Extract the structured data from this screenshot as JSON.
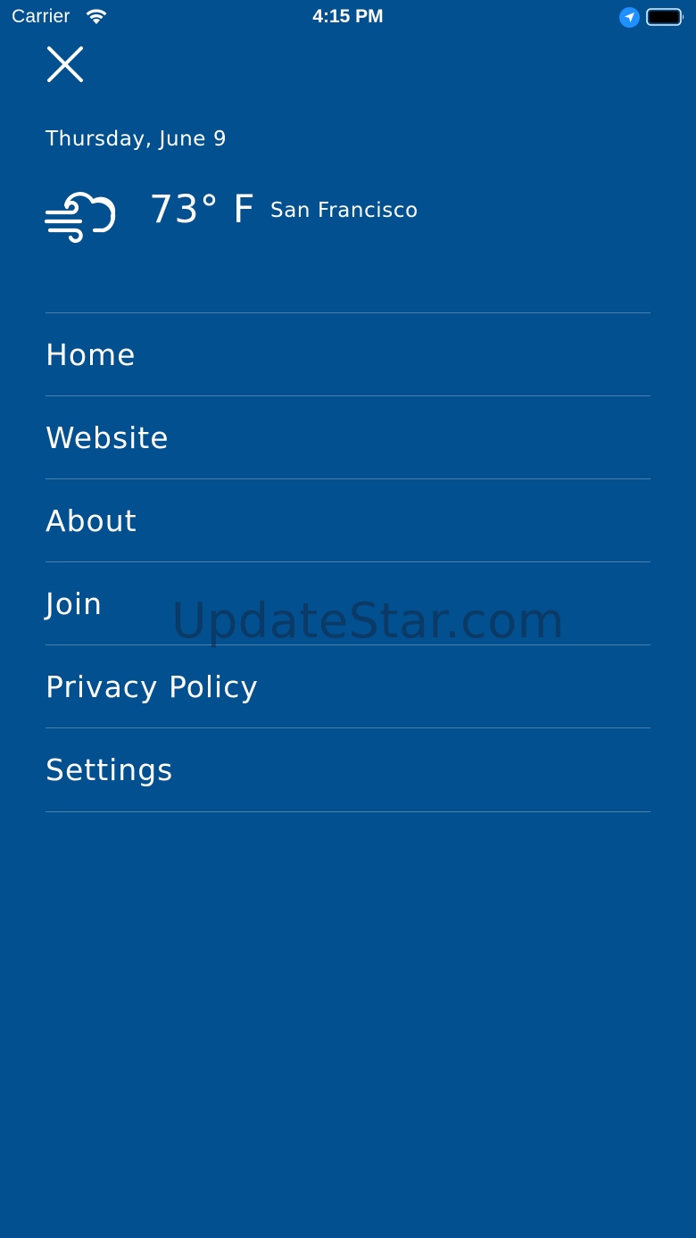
{
  "status_bar": {
    "carrier": "Carrier",
    "time": "4:15 PM",
    "icons": [
      "wifi-icon",
      "location-arrow-icon",
      "battery-icon"
    ]
  },
  "header": {
    "close_icon": "close-icon",
    "date": "Thursday, June 9",
    "weather_icon": "windy-cloud-icon",
    "temperature": "73° F",
    "location": "San Francisco"
  },
  "menu": {
    "items": [
      {
        "label": "Home"
      },
      {
        "label": "Website"
      },
      {
        "label": "About"
      },
      {
        "label": "Join"
      },
      {
        "label": "Privacy Policy"
      },
      {
        "label": "Settings"
      }
    ]
  },
  "watermark": "UpdateStar.com",
  "colors": {
    "background": "#02508F",
    "text": "#FFFFFF",
    "divider": "rgba(255,255,255,0.28)",
    "location_icon": "#1E90FF"
  }
}
